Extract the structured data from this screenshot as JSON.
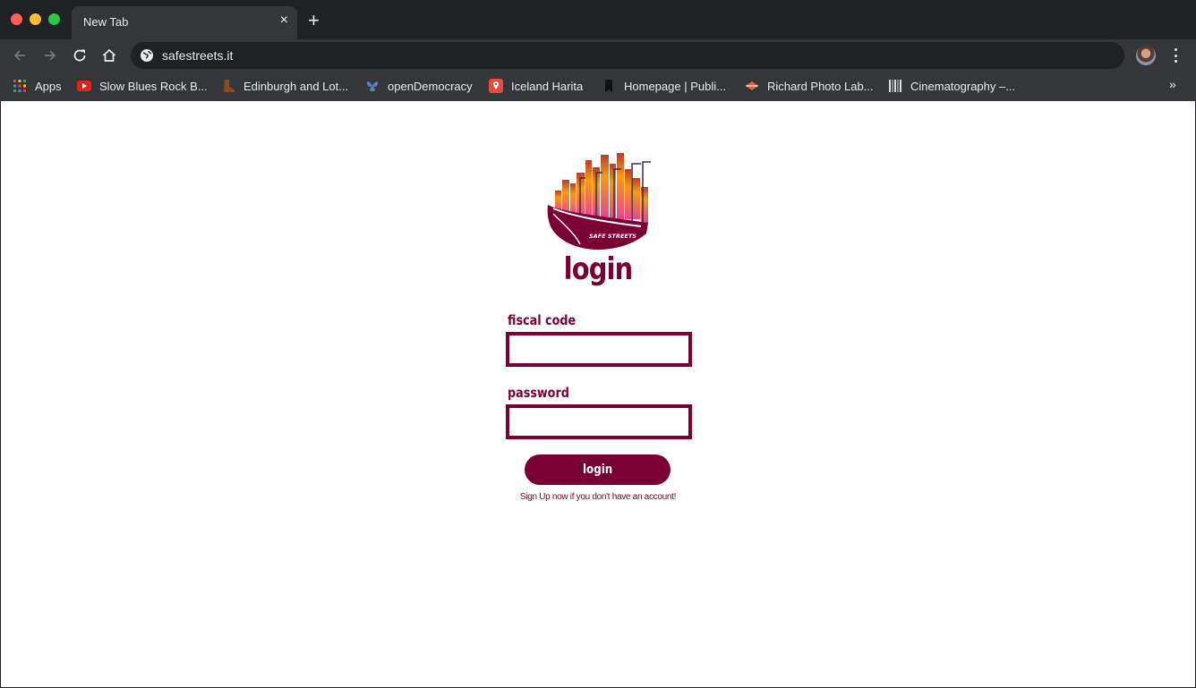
{
  "browser": {
    "tab": {
      "title": "New Tab",
      "close": "×"
    },
    "new_tab": "+",
    "url": "safestreets.it",
    "bookmarks": [
      {
        "label": "Apps",
        "icon": "apps-grid-icon"
      },
      {
        "label": "Slow Blues Rock B...",
        "icon": "youtube-icon"
      },
      {
        "label": "Edinburgh and Lot...",
        "icon": "boot-icon"
      },
      {
        "label": "openDemocracy",
        "icon": "butterfly-icon"
      },
      {
        "label": "Iceland Harita",
        "icon": "map-pin-icon"
      },
      {
        "label": "Homepage | Publi...",
        "icon": "bookmark-icon"
      },
      {
        "label": "Richard Photo Lab...",
        "icon": "diamond-icon"
      },
      {
        "label": "Cinematography –...",
        "icon": "barcode-icon"
      }
    ],
    "more": "»"
  },
  "page": {
    "title": "login",
    "logo_text": "SAFE STREETS",
    "fiscal_code": {
      "label": "fiscal code",
      "value": "",
      "placeholder": ""
    },
    "password": {
      "label": "password",
      "value": "",
      "placeholder": ""
    },
    "login_button": "login",
    "signup_text": "Sign Up now if you don't have an account!"
  },
  "colors": {
    "brand": "#7a0033",
    "chrome_dark": "#202124",
    "chrome_toolbar": "#35363a"
  }
}
